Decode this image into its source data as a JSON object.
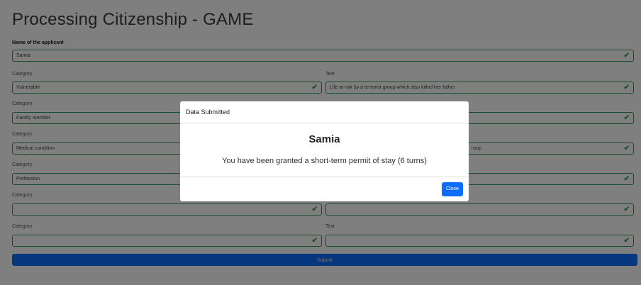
{
  "page": {
    "title": "Processing Citizenship - GAME"
  },
  "form": {
    "applicant_label": "Name of the applicant",
    "applicant_value": "Samia",
    "rows": [
      {
        "category_label": "Category",
        "category_value": "Vulnerable",
        "text_label": "Text",
        "text_value": "Life at risk by a terrorist group which also killed her father"
      },
      {
        "category_label": "Category",
        "category_value": "Family member",
        "text_label": "",
        "text_value": ""
      },
      {
        "category_label": "Category",
        "category_value": "Medical condition",
        "text_label": "",
        "text_value": "roup"
      },
      {
        "category_label": "Category",
        "category_value": "Profession",
        "text_label": "",
        "text_value": ""
      },
      {
        "category_label": "Category",
        "category_value": "",
        "text_label": "",
        "text_value": ""
      },
      {
        "category_label": "Category",
        "category_value": "",
        "text_label": "Text",
        "text_value": ""
      }
    ],
    "submit_label": "Submit"
  },
  "modal": {
    "header": "Data Submitted",
    "name": "Samia",
    "message": "You have been granted a short-term permit of stay (6 turns)",
    "close_label": "Close"
  },
  "icons": {
    "valid": "check-icon"
  },
  "colors": {
    "valid_border": "#2e9c52",
    "primary": "#0d6efd"
  }
}
